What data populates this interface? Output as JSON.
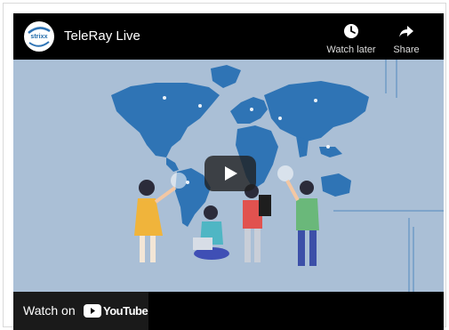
{
  "video": {
    "title": "TeleRay Live",
    "channel_logo_text": "strixx",
    "actions": {
      "watch_later_label": "Watch later",
      "watch_later_icon": "clock-icon",
      "share_label": "Share",
      "share_icon": "share-arrow-icon"
    },
    "play_icon": "play-icon",
    "watch_on_label": "Watch on",
    "youtube_wordmark": "YouTube"
  },
  "colors": {
    "scene_background": "#aabfd6",
    "map_blue": "#2f74b5",
    "bar_black": "#000000",
    "youtube_red": "#ff0000"
  }
}
